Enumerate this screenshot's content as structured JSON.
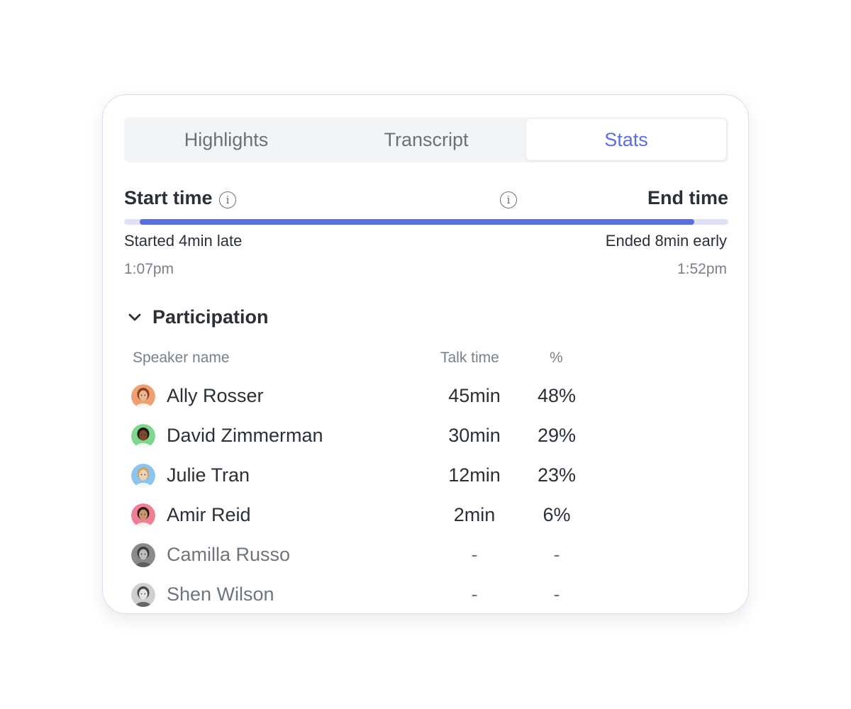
{
  "tabs": [
    {
      "label": "Highlights",
      "active": false
    },
    {
      "label": "Transcript",
      "active": false
    },
    {
      "label": "Stats",
      "active": true
    }
  ],
  "timeline": {
    "start_label": "Start time",
    "end_label": "End time",
    "start_status": "Started 4min late",
    "end_status": "Ended 8min early",
    "start_time": "1:07pm",
    "end_time": "1:52pm",
    "track_color": "#dfe2f7",
    "fill_color": "#5b6ee1"
  },
  "participation": {
    "title": "Participation",
    "columns": {
      "speaker": "Speaker name",
      "talk": "Talk time",
      "pct": "%"
    },
    "rows": [
      {
        "name": "Ally Rosser",
        "talk": "45min",
        "pct": "48%",
        "avatar_bg": "#f0a070",
        "muted": false
      },
      {
        "name": "David Zimmerman",
        "talk": "30min",
        "pct": "29%",
        "avatar_bg": "#7fd68f",
        "muted": false
      },
      {
        "name": "Julie Tran",
        "talk": "12min",
        "pct": "23%",
        "avatar_bg": "#8cc4f0",
        "muted": false
      },
      {
        "name": "Amir Reid",
        "talk": "2min",
        "pct": "6%",
        "avatar_bg": "#f07f95",
        "muted": false
      },
      {
        "name": "Camilla Russo",
        "talk": "-",
        "pct": "-",
        "avatar_bg": "#8a8a8a",
        "muted": true
      },
      {
        "name": "Shen Wilson",
        "talk": "-",
        "pct": "-",
        "avatar_bg": "#cfcfcf",
        "muted": true
      }
    ]
  },
  "colors": {
    "accent": "#5b6ee1",
    "card_border": "#d9dcf3"
  }
}
